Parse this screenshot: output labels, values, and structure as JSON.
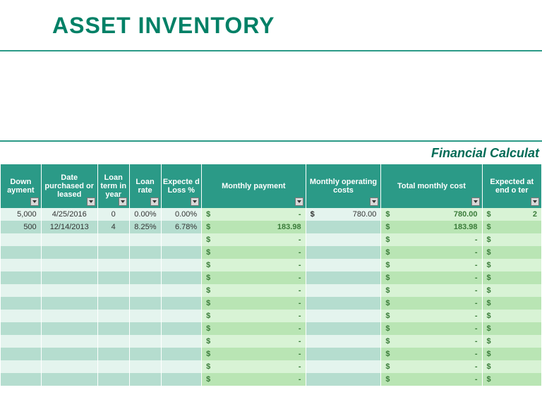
{
  "title": "ASSET INVENTORY",
  "section_header": "Financial Calculat",
  "columns": {
    "down_payment": "Down ayment",
    "date": "Date purchased or leased",
    "loan_term": "Loan term in year",
    "loan_rate": "Loan rate",
    "expected_loss": "Expecte d Loss %",
    "monthly_payment": "Monthly payment",
    "monthly_operating": "Monthly operating costs",
    "total_monthly": "Total monthly cost",
    "expected_value": "Expected at end o ter"
  },
  "rows": [
    {
      "down": "5,000",
      "date": "4/25/2016",
      "term": "0",
      "rate": "0.00%",
      "loss": "0.00%",
      "mpay": "-",
      "opcost": "780.00",
      "tmcost": "780.00",
      "expval": "2"
    },
    {
      "down": "500",
      "date": "12/14/2013",
      "term": "4",
      "rate": "8.25%",
      "loss": "6.78%",
      "mpay": "183.98",
      "opcost": "",
      "tmcost": "183.98",
      "expval": ""
    },
    {
      "mpay": "-",
      "tmcost": "-",
      "expval": ""
    },
    {
      "mpay": "-",
      "tmcost": "-",
      "expval": ""
    },
    {
      "mpay": "-",
      "tmcost": "-",
      "expval": ""
    },
    {
      "mpay": "-",
      "tmcost": "-",
      "expval": ""
    },
    {
      "mpay": "-",
      "tmcost": "-",
      "expval": ""
    },
    {
      "mpay": "-",
      "tmcost": "-",
      "expval": ""
    },
    {
      "mpay": "-",
      "tmcost": "-",
      "expval": ""
    },
    {
      "mpay": "-",
      "tmcost": "-",
      "expval": ""
    },
    {
      "mpay": "-",
      "tmcost": "-",
      "expval": ""
    },
    {
      "mpay": "-",
      "tmcost": "-",
      "expval": ""
    },
    {
      "mpay": "-",
      "tmcost": "-",
      "expval": ""
    },
    {
      "mpay": "-",
      "tmcost": "-",
      "expval": ""
    }
  ]
}
